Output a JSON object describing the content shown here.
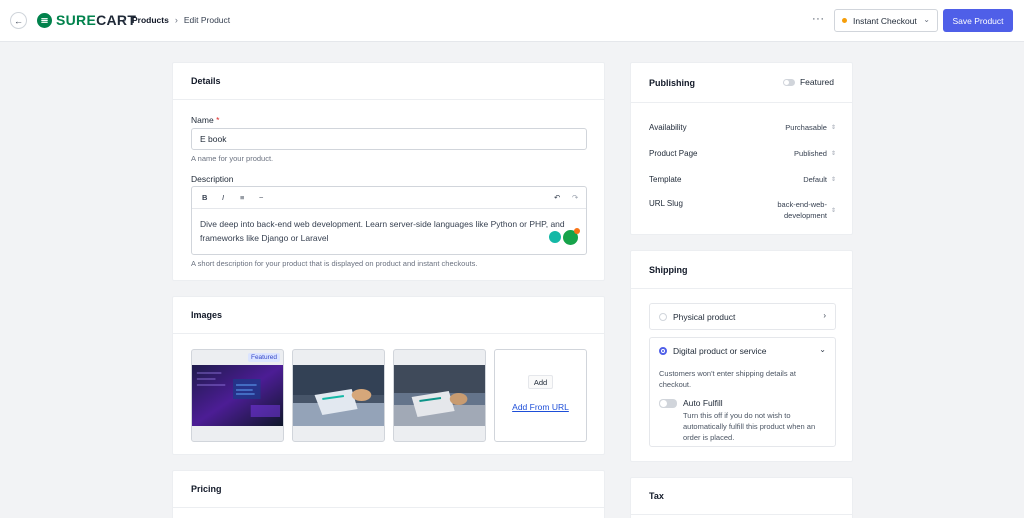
{
  "topbar": {
    "back_icon": "arrow-left-icon",
    "logo_text_accent": "SURE",
    "logo_text_rest": "CART",
    "breadcrumbs": [
      "Products",
      "Edit Product"
    ],
    "more_label": "···",
    "checkout_select": "Instant Checkout",
    "checkout_status_color": "#f59e0b",
    "save_label": "Save Product",
    "accent_color": "#4f5fe8"
  },
  "details": {
    "title": "Details",
    "name_label": "Name",
    "required_mark": "*",
    "name_value": "E book",
    "name_help": "A name for your product.",
    "description_label": "Description",
    "toolbar": [
      "B",
      "I",
      "≡",
      "~"
    ],
    "undo": "↶",
    "redo": "↷",
    "description_value": "Dive deep into back-end web development. Learn server-side languages like Python or PHP, and frameworks like Django or Laravel",
    "description_help": "A short description for your product that is displayed on product and instant checkouts."
  },
  "images": {
    "title": "Images",
    "featured_tag": "Featured",
    "add_label": "Add",
    "add_url_label": "Add From URL"
  },
  "pricing": {
    "title": "Pricing"
  },
  "publishing": {
    "title": "Publishing",
    "featured_label": "Featured",
    "rows": [
      {
        "label": "Availability",
        "value": "Purchasable"
      },
      {
        "label": "Product Page",
        "value": "Published"
      },
      {
        "label": "Template",
        "value": "Default"
      },
      {
        "label": "URL Slug",
        "value_line1": "back-end-web-",
        "value_line2": "development"
      }
    ]
  },
  "shipping": {
    "title": "Shipping",
    "physical_label": "Physical product",
    "digital_label": "Digital product or service",
    "digital_note": "Customers won't enter shipping details at checkout.",
    "auto_fulfill_label": "Auto Fulfill",
    "auto_fulfill_note": "Turn this off if you do not wish to automatically fulfill this product when an order is placed."
  },
  "tax": {
    "title": "Tax"
  }
}
